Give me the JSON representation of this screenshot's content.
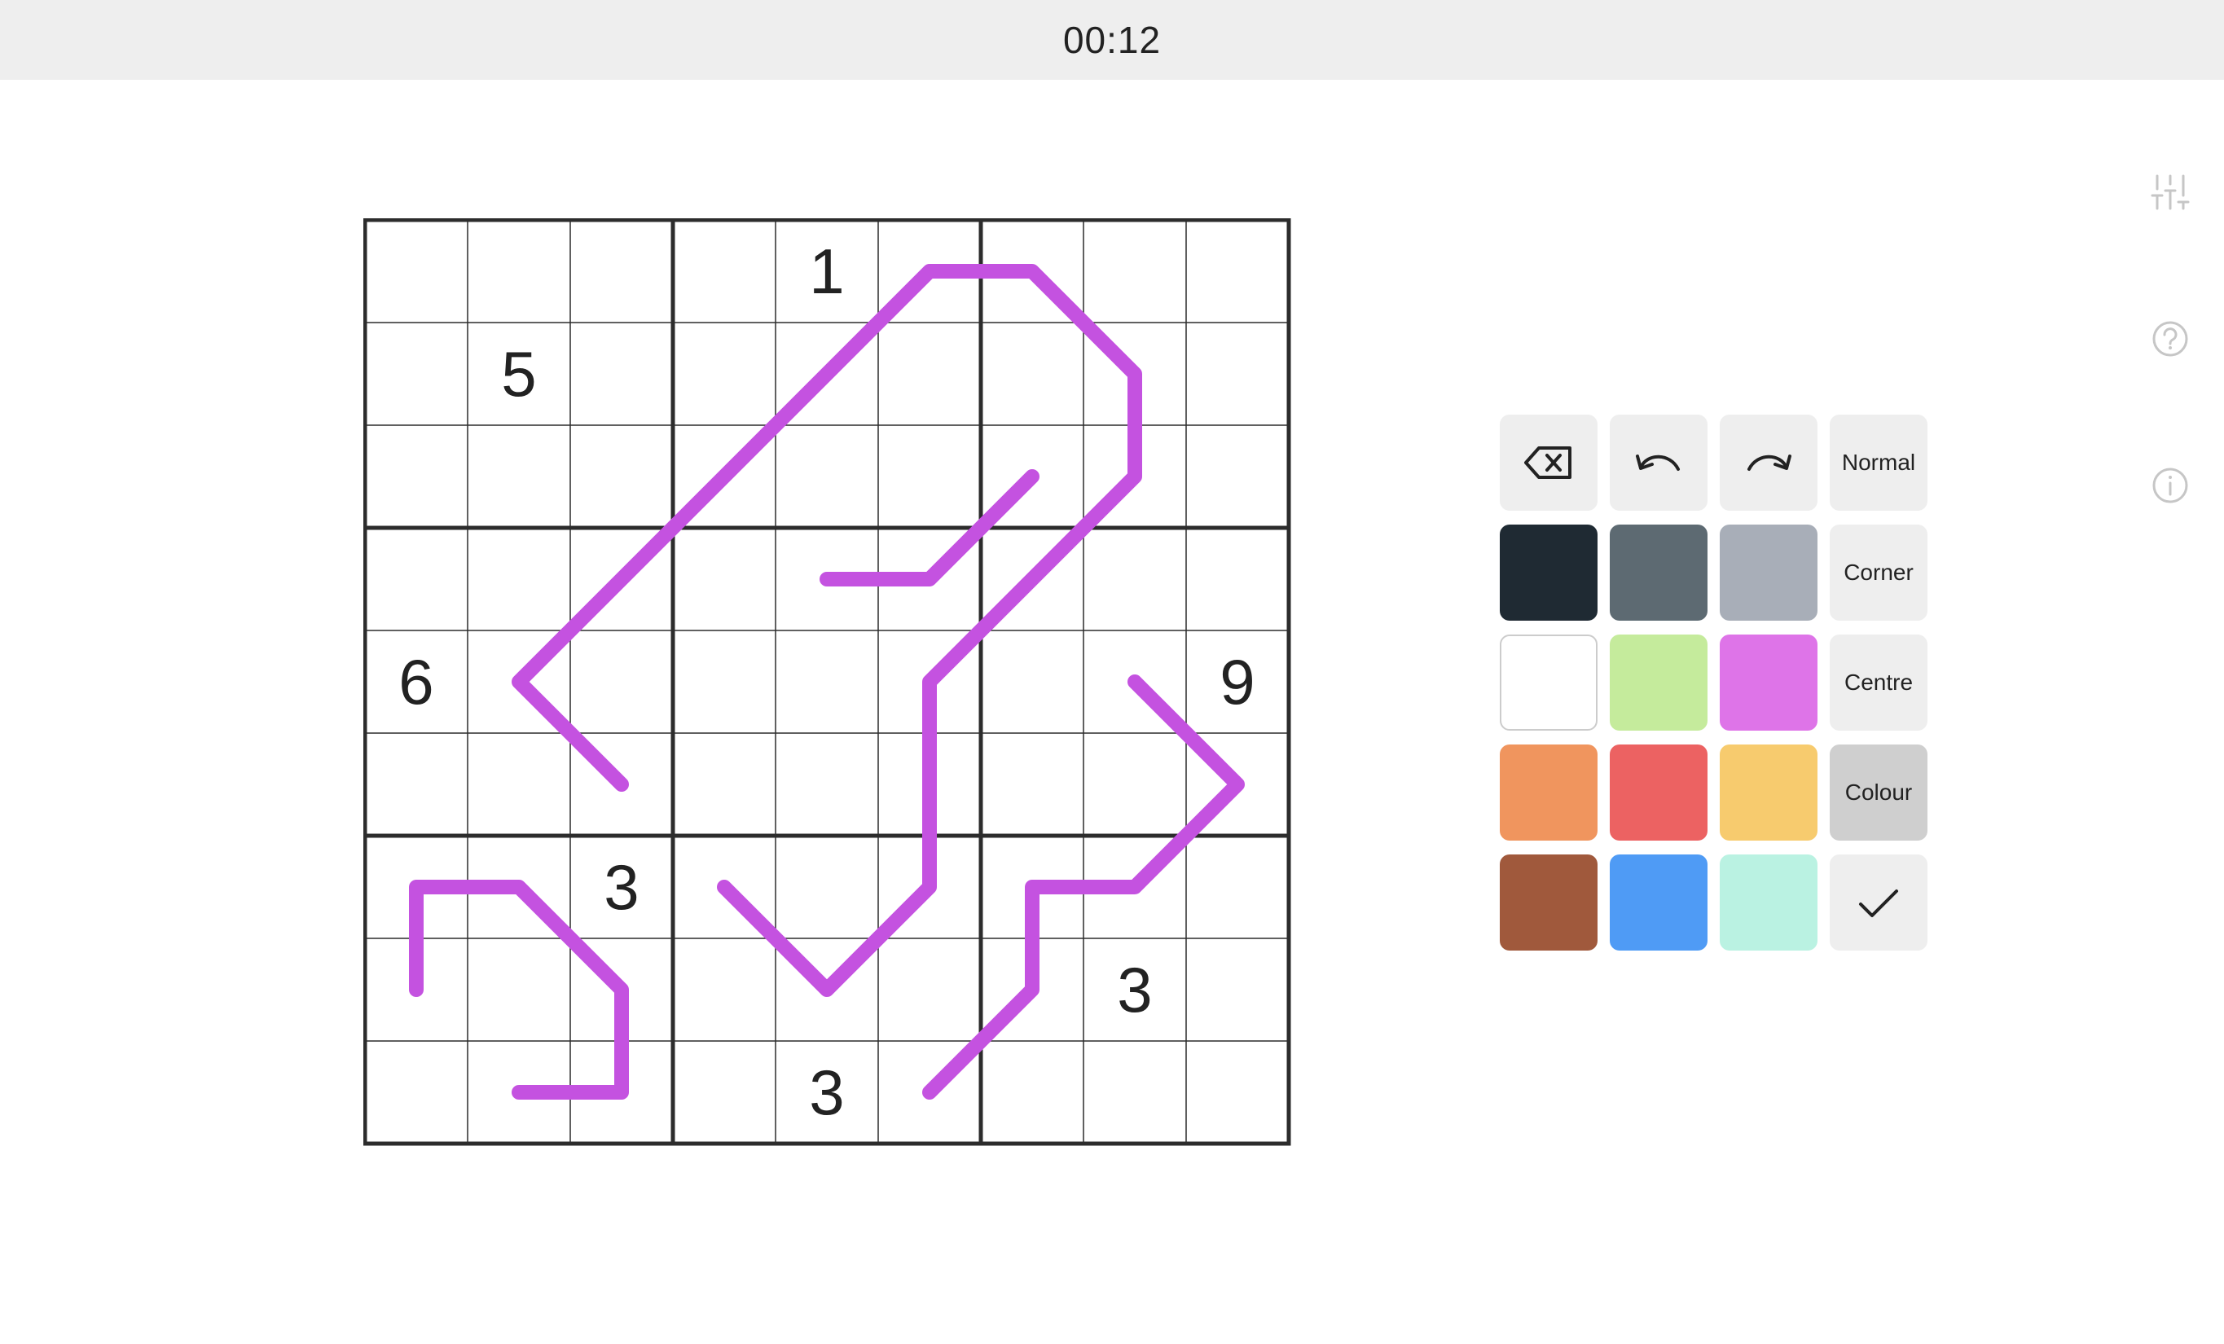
{
  "timer": "00:12",
  "grid": {
    "size": 9,
    "givens": [
      {
        "row": 0,
        "col": 4,
        "value": "1"
      },
      {
        "row": 1,
        "col": 1,
        "value": "5"
      },
      {
        "row": 4,
        "col": 0,
        "value": "6"
      },
      {
        "row": 4,
        "col": 8,
        "value": "9"
      },
      {
        "row": 6,
        "col": 2,
        "value": "3"
      },
      {
        "row": 7,
        "col": 7,
        "value": "3"
      },
      {
        "row": 8,
        "col": 4,
        "value": "3"
      }
    ],
    "line_color": "#c452e0",
    "lines": [
      [
        [
          6.0,
          0.5
        ],
        [
          6.5,
          0.5
        ],
        [
          7.5,
          1.5
        ],
        [
          7.5,
          2.5
        ],
        [
          6.5,
          3.5
        ],
        [
          5.5,
          4.5
        ],
        [
          5.5,
          6.5
        ],
        [
          4.5,
          7.5
        ],
        [
          3.5,
          6.5
        ]
      ],
      [
        [
          6.0,
          0.5
        ],
        [
          5.5,
          0.5
        ],
        [
          4.5,
          1.5
        ],
        [
          3.5,
          2.5
        ],
        [
          2.5,
          3.5
        ],
        [
          1.5,
          4.5
        ],
        [
          2.5,
          5.5
        ]
      ],
      [
        [
          6.5,
          2.5
        ],
        [
          5.5,
          3.5
        ],
        [
          4.5,
          3.5
        ]
      ],
      [
        [
          0.5,
          7.5
        ],
        [
          0.5,
          6.5
        ],
        [
          1.5,
          6.5
        ],
        [
          2.5,
          7.5
        ],
        [
          2.5,
          8.5
        ],
        [
          1.5,
          8.5
        ]
      ],
      [
        [
          7.5,
          4.5
        ],
        [
          8.5,
          5.5
        ],
        [
          7.5,
          6.5
        ],
        [
          6.5,
          6.5
        ],
        [
          6.5,
          7.5
        ],
        [
          5.5,
          8.5
        ]
      ]
    ]
  },
  "side_icons": [
    "sliders-icon",
    "help-icon",
    "info-icon"
  ],
  "pad": {
    "modes": {
      "normal": "Normal",
      "corner": "Corner",
      "centre": "Centre",
      "colour": "Colour"
    },
    "active_mode": "Colour",
    "colors": {
      "black": "#1f2a33",
      "dark_grey": "#5d6a72",
      "light_grey": "#a8aeb8",
      "white": "#ffffff",
      "light_green": "#c5eb9c",
      "magenta": "#de74e8",
      "orange": "#f0955e",
      "red": "#ec6262",
      "yellow": "#f7cb6e",
      "brown": "#a0593c",
      "blue": "#4f9bf5",
      "mint": "#baf2e2"
    }
  }
}
